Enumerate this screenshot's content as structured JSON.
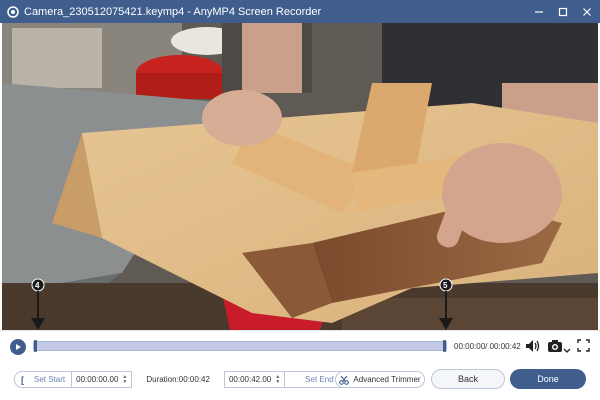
{
  "window": {
    "title": "Camera_230512075421.keymp4  -  AnyMP4 Screen Recorder",
    "icons": [
      "app-logo-icon",
      "minimize-icon",
      "maximize-icon",
      "close-icon"
    ]
  },
  "annotations": {
    "marker_start": "4",
    "marker_end": "5"
  },
  "player": {
    "play_icon": "play-icon",
    "time_readout": "00:00:00/ 00:00:42",
    "progress": 0.0,
    "trim_start_fraction": 0.0,
    "trim_end_fraction": 1.0,
    "icons": [
      "volume-icon",
      "camera-icon",
      "chevron-down-icon",
      "fullscreen-icon"
    ]
  },
  "trim": {
    "start_bracket": "[",
    "set_start_label": "Set Start",
    "start_time": "00:00:00.00",
    "duration_label": "Duration:00:00:42",
    "end_time": "00:00:42.00",
    "set_end_label": "Set End",
    "end_bracket": "]"
  },
  "buttons": {
    "advanced_trimmer": "Advanced Trimmer",
    "back": "Back",
    "done": "Done"
  },
  "colors": {
    "accent": "#3f5e8e",
    "timeline_fill": "#c3cae6"
  }
}
